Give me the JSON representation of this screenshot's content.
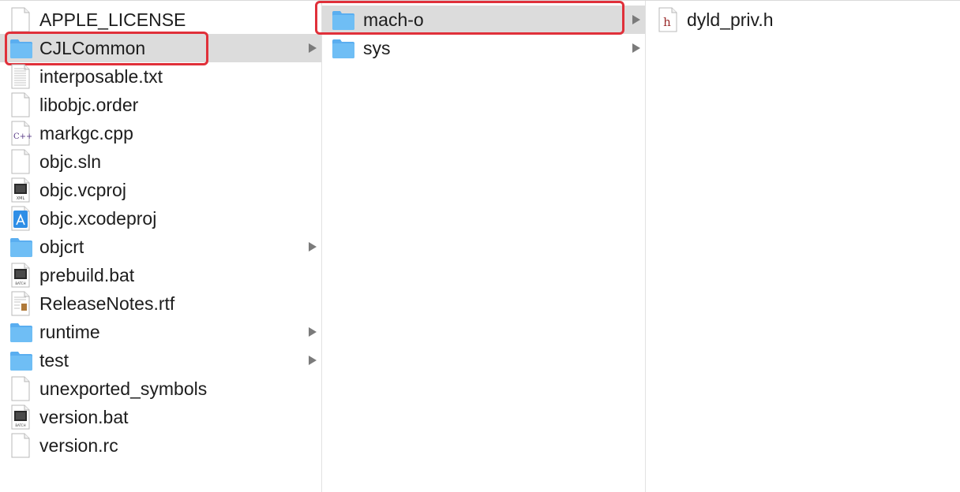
{
  "columns": [
    {
      "items": [
        {
          "name": "APPLE_LICENSE",
          "kind": "document-icon",
          "has_children": false
        },
        {
          "name": "CJLCommon",
          "kind": "folder-icon",
          "has_children": true,
          "selected": true,
          "annotated": true
        },
        {
          "name": "interposable.txt",
          "kind": "text-document-icon",
          "has_children": false
        },
        {
          "name": "libobjc.order",
          "kind": "document-icon",
          "has_children": false
        },
        {
          "name": "markgc.cpp",
          "kind": "cpp-source-icon",
          "has_children": false,
          "badge": "C++"
        },
        {
          "name": "objc.sln",
          "kind": "document-icon",
          "has_children": false
        },
        {
          "name": "objc.vcproj",
          "kind": "xml-document-icon",
          "has_children": false,
          "badge": "XML"
        },
        {
          "name": "objc.xcodeproj",
          "kind": "xcode-project-icon",
          "has_children": false
        },
        {
          "name": "objcrt",
          "kind": "folder-icon",
          "has_children": true
        },
        {
          "name": "prebuild.bat",
          "kind": "batch-file-icon",
          "has_children": false,
          "badge": "BATCH"
        },
        {
          "name": "ReleaseNotes.rtf",
          "kind": "rtf-document-icon",
          "has_children": false
        },
        {
          "name": "runtime",
          "kind": "folder-icon",
          "has_children": true
        },
        {
          "name": "test",
          "kind": "folder-icon",
          "has_children": true
        },
        {
          "name": "unexported_symbols",
          "kind": "document-icon",
          "has_children": false
        },
        {
          "name": "version.bat",
          "kind": "batch-file-icon",
          "has_children": false,
          "badge": "BATCH"
        },
        {
          "name": "version.rc",
          "kind": "document-icon",
          "has_children": false
        }
      ]
    },
    {
      "items": [
        {
          "name": "mach-o",
          "kind": "folder-icon",
          "has_children": true,
          "selected": true,
          "annotated": true
        },
        {
          "name": "sys",
          "kind": "folder-icon",
          "has_children": true
        }
      ]
    },
    {
      "items": [
        {
          "name": "dyld_priv.h",
          "kind": "header-file-icon",
          "has_children": false,
          "badge": "h"
        }
      ]
    }
  ],
  "colors": {
    "selection": "#dcdcdc",
    "annotation": "#e0303a",
    "folder": "#6fbef5",
    "chevron": "#7b7b7b"
  }
}
